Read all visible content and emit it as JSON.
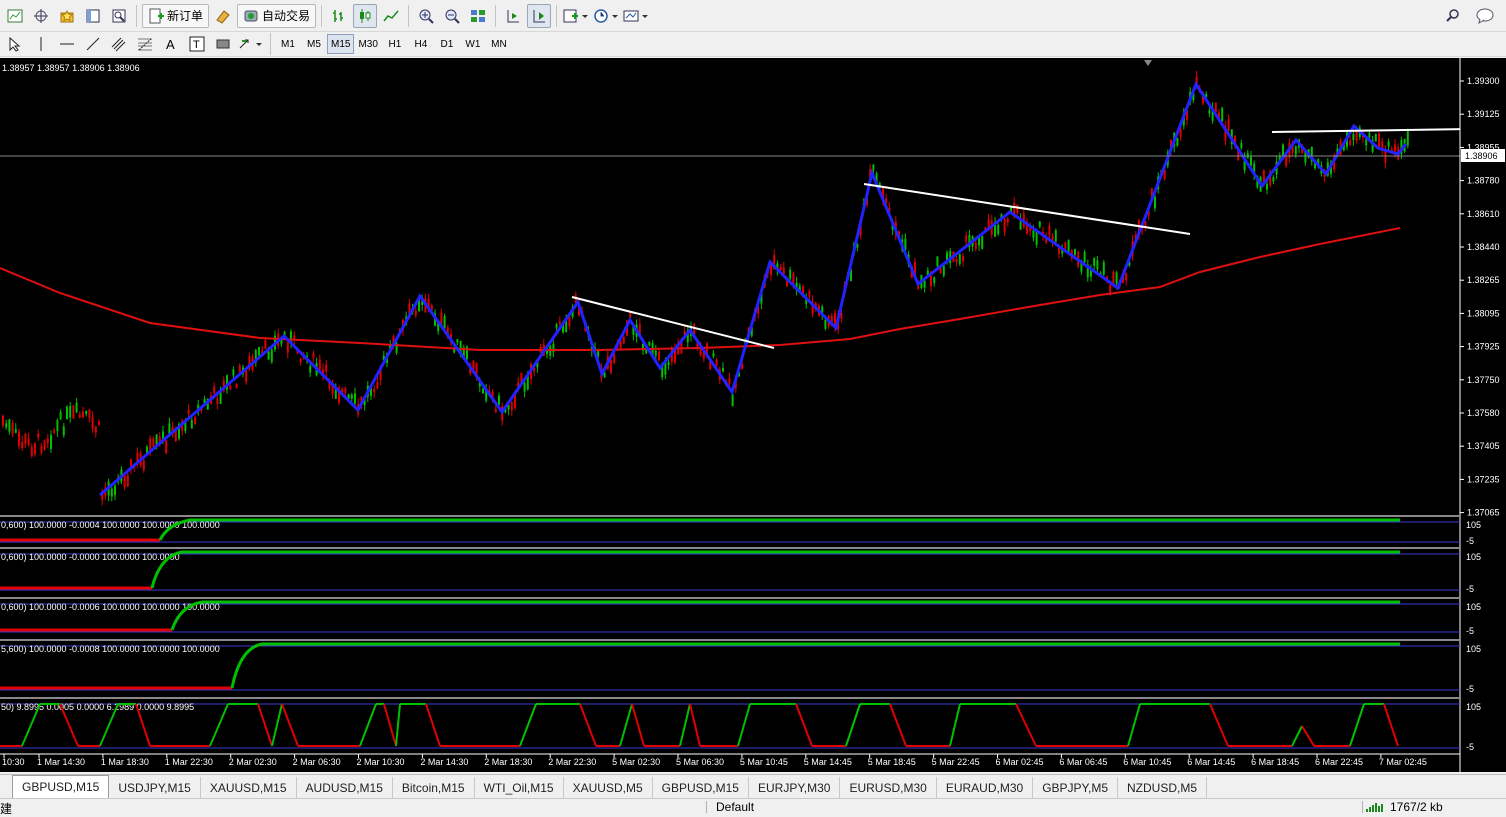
{
  "toolbar": {
    "new_order": "新订单",
    "auto_trading": "自动交易",
    "timeframes": [
      "M1",
      "M5",
      "M15",
      "M30",
      "H1",
      "H4",
      "D1",
      "W1",
      "MN"
    ],
    "active_timeframe": "M15"
  },
  "chart": {
    "ohlc": "1.38957 1.38957 1.38906 1.38906",
    "current_price": "1.38906",
    "price_axis": [
      "1.39300",
      "1.39125",
      "1.38955",
      "1.38780",
      "1.38610",
      "1.38440",
      "1.38265",
      "1.38095",
      "1.37925",
      "1.37750",
      "1.37580",
      "1.37405",
      "1.37235",
      "1.37065"
    ],
    "time_axis": [
      "10:30",
      "1 Mar 14:30",
      "1 Mar 18:30",
      "1 Mar 22:30",
      "2 Mar 02:30",
      "2 Mar 06:30",
      "2 Mar 10:30",
      "2 Mar 14:30",
      "2 Mar 18:30",
      "2 Mar 22:30",
      "5 Mar 02:30",
      "5 Mar 06:30",
      "5 Mar 10:45",
      "5 Mar 14:45",
      "5 Mar 18:45",
      "5 Mar 22:45",
      "6 Mar 02:45",
      "6 Mar 06:45",
      "6 Mar 10:45",
      "6 Mar 14:45",
      "6 Mar 18:45",
      "6 Mar 22:45",
      "7 Mar 02:45"
    ],
    "colors": {
      "bull": "#00c000",
      "bear": "#e00000",
      "zigzag": "#2222ff",
      "trendline": "#ffffff",
      "ma": "#e01010"
    }
  },
  "indicators": [
    {
      "label": "0,600) 100.0000 -0.0004 100.0000 100.0000 100.0000",
      "scale_top": "105",
      "scale_bottom": "-5"
    },
    {
      "label": "0,600) 100.0000 -0.0000 100.0000 100.0000",
      "scale_top": "105",
      "scale_bottom": "-5"
    },
    {
      "label": "0,600) 100.0000 -0.0006 100.0000 100.0000 100.0000",
      "scale_top": "105",
      "scale_bottom": "-5"
    },
    {
      "label": "5,600) 100.0000 -0.0008 100.0000 100.0000 100.0000",
      "scale_top": "105",
      "scale_bottom": "-5"
    },
    {
      "label": "50) 9.8995 0.0005 0.0000 6.2989 0.0000 9.8995",
      "scale_top": "105",
      "scale_bottom": "-5"
    }
  ],
  "tabs": [
    "GBPUSD,M15",
    "USDJPY,M15",
    "XAUUSD,M15",
    "AUDUSD,M15",
    "Bitcoin,M15",
    "WTI_Oil,M15",
    "XAUUSD,M5",
    "GBPUSD,M15",
    "EURJPY,M30",
    "EURUSD,M30",
    "EURAUD,M30",
    "GBPJPY,M5",
    "NZDUSD,M5"
  ],
  "status": {
    "left": "建",
    "profile": "Default",
    "traffic": "1767/2 kb"
  }
}
